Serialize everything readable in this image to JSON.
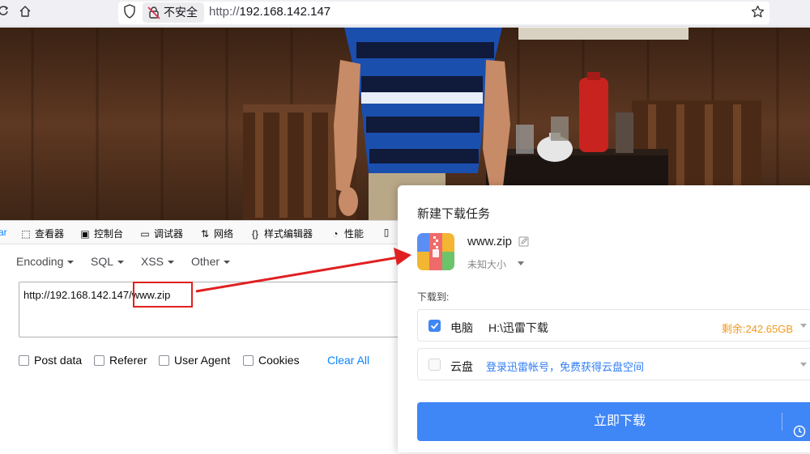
{
  "browser": {
    "insecure_label": "不安全",
    "url_scheme": "http://",
    "url_host": "192.168.142.147"
  },
  "devtools": {
    "tabs": [
      {
        "label": "ar",
        "icon": "tab-fragment"
      },
      {
        "label": "查看器",
        "icon": "inspector-icon"
      },
      {
        "label": "控制台",
        "icon": "console-icon"
      },
      {
        "label": "调试器",
        "icon": "debugger-icon"
      },
      {
        "label": "网络",
        "icon": "network-icon"
      },
      {
        "label": "样式编辑器",
        "icon": "style-editor-icon"
      },
      {
        "label": "性能",
        "icon": "performance-icon"
      }
    ]
  },
  "hackbar": {
    "menus": [
      "Encoding",
      "SQL",
      "XSS",
      "Other"
    ],
    "url_value": "http://192.168.142.147/www.zip",
    "options": [
      "Post data",
      "Referer",
      "User Agent",
      "Cookies"
    ],
    "clear_all": "Clear All"
  },
  "download_dialog": {
    "title": "新建下载任务",
    "file_name": "www.zip",
    "file_size": "未知大小",
    "download_to_label": "下载到:",
    "locations": [
      {
        "name": "电脑",
        "path": "H:\\迅雷下载",
        "free": "剩余:242.65GB",
        "checked": true
      },
      {
        "name": "云盘",
        "link": "登录迅雷帐号，免费获得云盘空间",
        "checked": false
      }
    ],
    "download_button": "立即下载"
  },
  "colors": {
    "accent_blue": "#3f86f6",
    "link_blue": "#0a84ff",
    "free_space_orange": "#f29a1d",
    "annotation_red": "#e02020"
  }
}
